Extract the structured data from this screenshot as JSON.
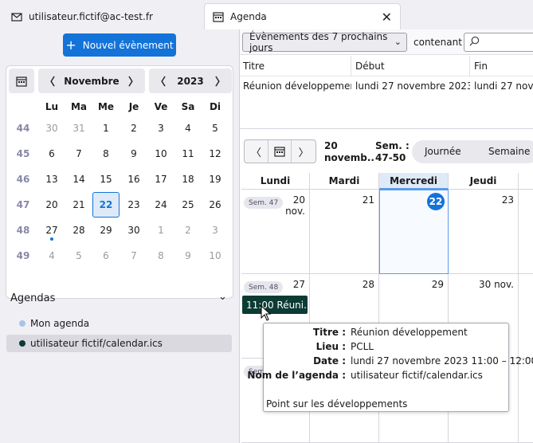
{
  "tabs": [
    {
      "label": "utilisateur.fictif@ac-test.fr",
      "icon": "mail-icon"
    },
    {
      "label": "Agenda",
      "icon": "calendar-icon",
      "active": true
    }
  ],
  "sidebar": {
    "new_event_label": "Nouvel évènement",
    "minimonth": {
      "month": "Novembre",
      "year": "2023",
      "weekdays": [
        "Lu",
        "Ma",
        "Me",
        "Je",
        "Ve",
        "Sa",
        "Di"
      ],
      "weeks": [
        {
          "wk": "44",
          "days": [
            "30",
            "31",
            "1",
            "2",
            "3",
            "4",
            "5"
          ]
        },
        {
          "wk": "45",
          "days": [
            "6",
            "7",
            "8",
            "9",
            "10",
            "11",
            "12"
          ]
        },
        {
          "wk": "46",
          "days": [
            "13",
            "14",
            "15",
            "16",
            "17",
            "18",
            "19"
          ]
        },
        {
          "wk": "47",
          "days": [
            "20",
            "21",
            "22",
            "23",
            "24",
            "25",
            "26"
          ]
        },
        {
          "wk": "48",
          "days": [
            "27",
            "28",
            "29",
            "30",
            "1",
            "2",
            "3"
          ]
        },
        {
          "wk": "49",
          "days": [
            "4",
            "5",
            "6",
            "7",
            "8",
            "9",
            "10"
          ]
        }
      ]
    },
    "agendas_title": "Agendas",
    "calendars": [
      {
        "name": "Mon agenda",
        "color": "#a8c4e6"
      },
      {
        "name": "utilisateur fictif/calendar.ics",
        "color": "#0c3b34"
      }
    ]
  },
  "toolbar": {
    "filter": "Évènements des 7 prochains jours",
    "contains_label": "contenant"
  },
  "event_list": {
    "columns": [
      "Titre",
      "Début",
      "Fin"
    ],
    "rows": [
      {
        "title": "Réunion développemen...",
        "start": "lundi 27 novembre 2023 1...",
        "end": "lundi 27 novem"
      }
    ]
  },
  "calendar_nav": {
    "date_line1": "20",
    "date_line2": "novemb...",
    "week_line1": "Sem. :",
    "week_line2": "47-50",
    "views": [
      "Journée",
      "Semaine"
    ]
  },
  "week_view": {
    "day_headers": [
      "Lundi",
      "Mardi",
      "Mercredi",
      "Jeudi"
    ],
    "rows": [
      {
        "week_badge": "Sem. 47",
        "days": [
          "20\nnov.",
          "21",
          "22",
          "23"
        ]
      },
      {
        "week_badge": "Sem. 48",
        "days": [
          "27",
          "28",
          "29",
          "30 nov."
        ]
      },
      {
        "week_badge": "Sem",
        "days": [
          "",
          "",
          "",
          ""
        ]
      }
    ]
  },
  "event_chip": {
    "label": "11:00 Réuni...",
    "color": "#0c3b34"
  },
  "tooltip": {
    "rows": [
      {
        "key": "Titre :",
        "value": "Réunion développement"
      },
      {
        "key": "Lieu :",
        "value": "PCLL"
      },
      {
        "key": "Date :",
        "value": "lundi 27 novembre 2023 11:00 – 12:00"
      },
      {
        "key": "Nom de l’agenda :",
        "value": "utilisateur fictif/calendar.ics"
      }
    ],
    "description": "Point sur les développements"
  }
}
